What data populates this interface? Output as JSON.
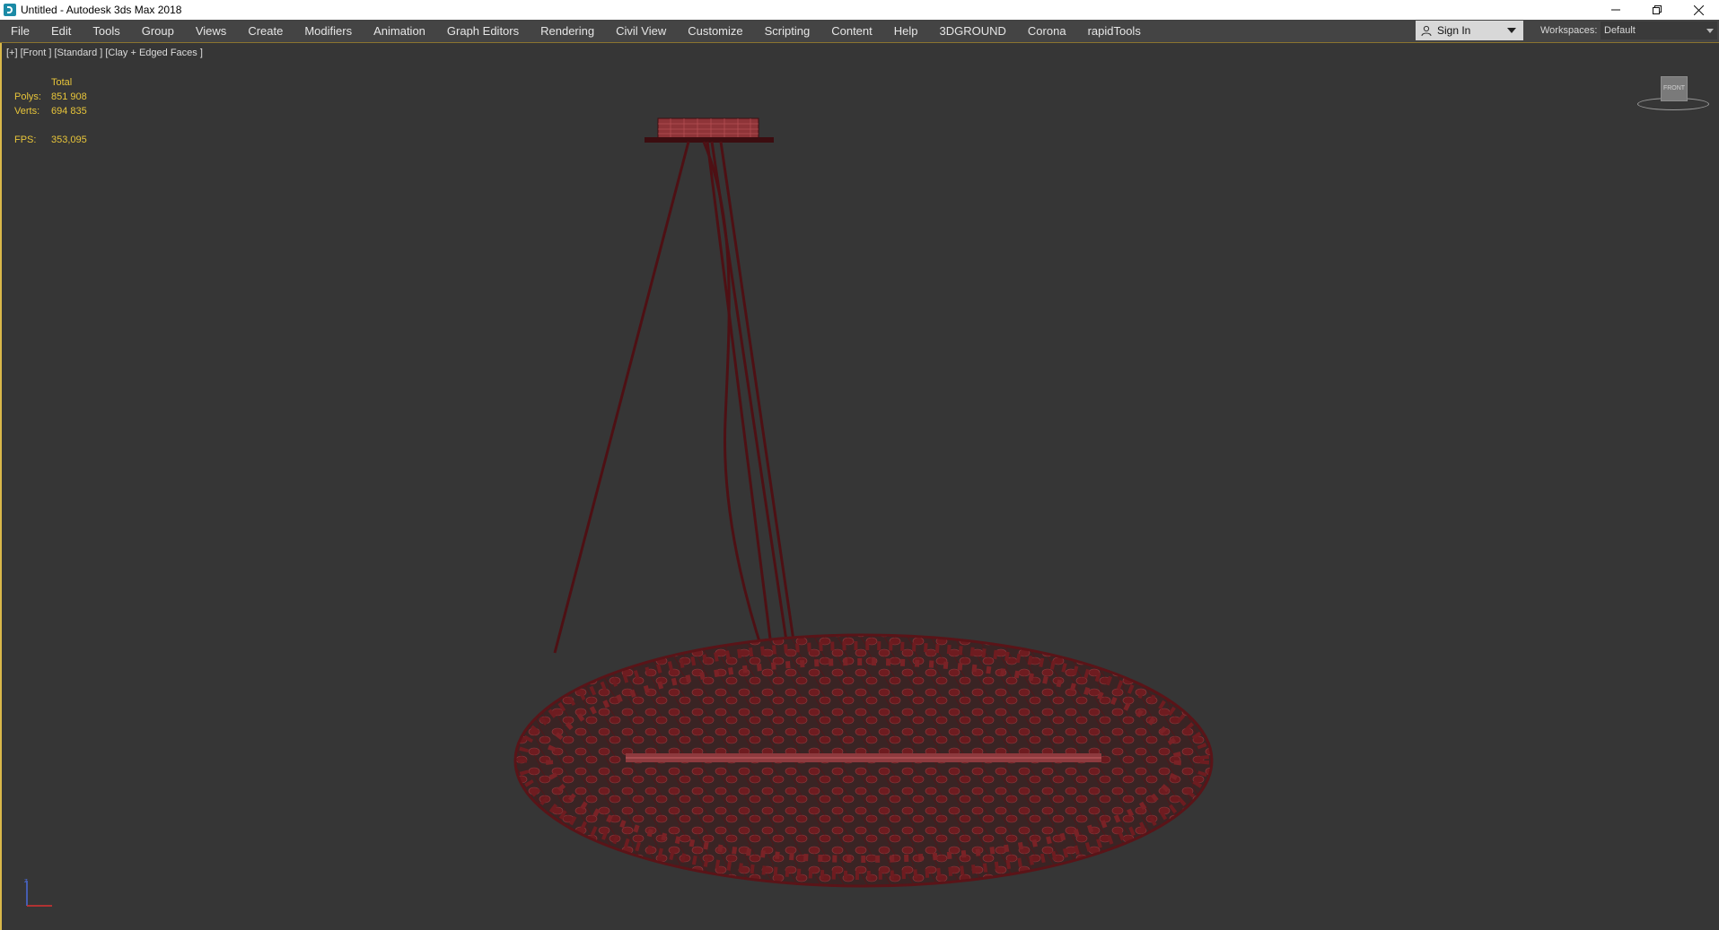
{
  "window": {
    "title": "Untitled - Autodesk 3ds Max 2018",
    "controls": [
      "minimize-icon",
      "restore-icon",
      "close-icon"
    ]
  },
  "menubar": {
    "items": [
      "File",
      "Edit",
      "Tools",
      "Group",
      "Views",
      "Create",
      "Modifiers",
      "Animation",
      "Graph Editors",
      "Rendering",
      "Civil View",
      "Customize",
      "Scripting",
      "Content",
      "Help",
      "3DGROUND",
      "Corona",
      "rapidTools"
    ],
    "sign_in": "Sign In",
    "workspaces_label": "Workspaces:",
    "workspace_value": "Default"
  },
  "viewport": {
    "label": "[+] [Front ] [Standard ] [Clay + Edged Faces ]",
    "stats": {
      "header": "Total",
      "polys_label": "Polys:",
      "polys_value": "851 908",
      "verts_label": "Verts:",
      "verts_value": "694 835",
      "fps_label": "FPS:",
      "fps_value": "353,095"
    },
    "viewcube_face": "FRONT",
    "accent_color": "#d9b84a",
    "model_color": "#7a1e22"
  }
}
